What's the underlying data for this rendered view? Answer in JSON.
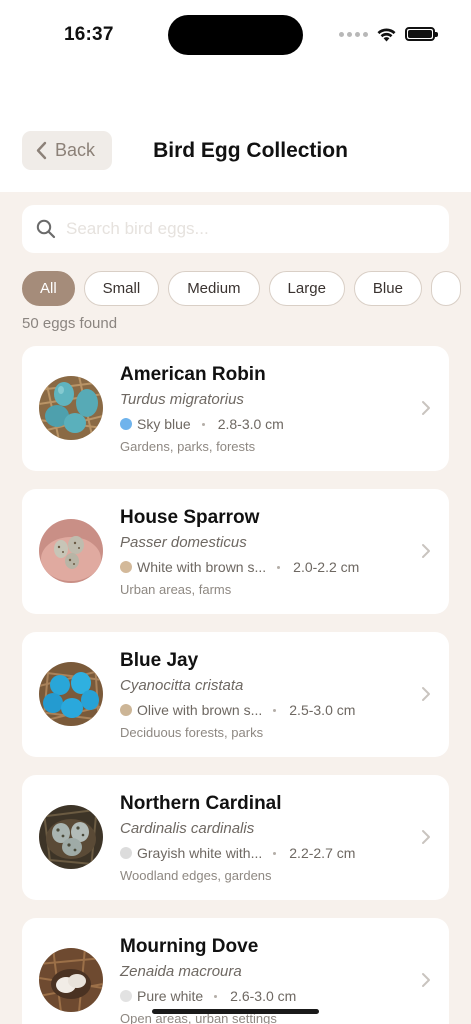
{
  "status_bar": {
    "time": "16:37"
  },
  "header": {
    "back_label": "Back",
    "title": "Bird Egg Collection"
  },
  "search": {
    "placeholder": "Search bird eggs...",
    "value": ""
  },
  "filters": [
    {
      "label": "All",
      "active": true
    },
    {
      "label": "Small",
      "active": false
    },
    {
      "label": "Medium",
      "active": false
    },
    {
      "label": "Large",
      "active": false
    },
    {
      "label": "Blue",
      "active": false
    }
  ],
  "results_count": "50 eggs found",
  "eggs": [
    {
      "name": "American Robin",
      "latin": "Turdus migratorius",
      "color_label": "Sky blue",
      "swatch": "#6fb3ec",
      "size": "2.8-3.0 cm",
      "habitat": "Gardens, parks, forests"
    },
    {
      "name": "House Sparrow",
      "latin": "Passer domesticus",
      "color_label": "White with brown s...",
      "swatch": "#d3b99a",
      "size": "2.0-2.2 cm",
      "habitat": "Urban areas, farms"
    },
    {
      "name": "Blue Jay",
      "latin": "Cyanocitta cristata",
      "color_label": "Olive with brown s...",
      "swatch": "#ccb596",
      "size": "2.5-3.0 cm",
      "habitat": "Deciduous forests, parks"
    },
    {
      "name": "Northern Cardinal",
      "latin": "Cardinalis cardinalis",
      "color_label": "Grayish white with...",
      "swatch": "#dcdcdc",
      "size": "2.2-2.7 cm",
      "habitat": "Woodland edges, gardens"
    },
    {
      "name": "Mourning Dove",
      "latin": "Zenaida macroura",
      "color_label": "Pure white",
      "swatch": "#e2e2e2",
      "size": "2.6-3.0 cm",
      "habitat": "Open areas, urban settings"
    }
  ]
}
